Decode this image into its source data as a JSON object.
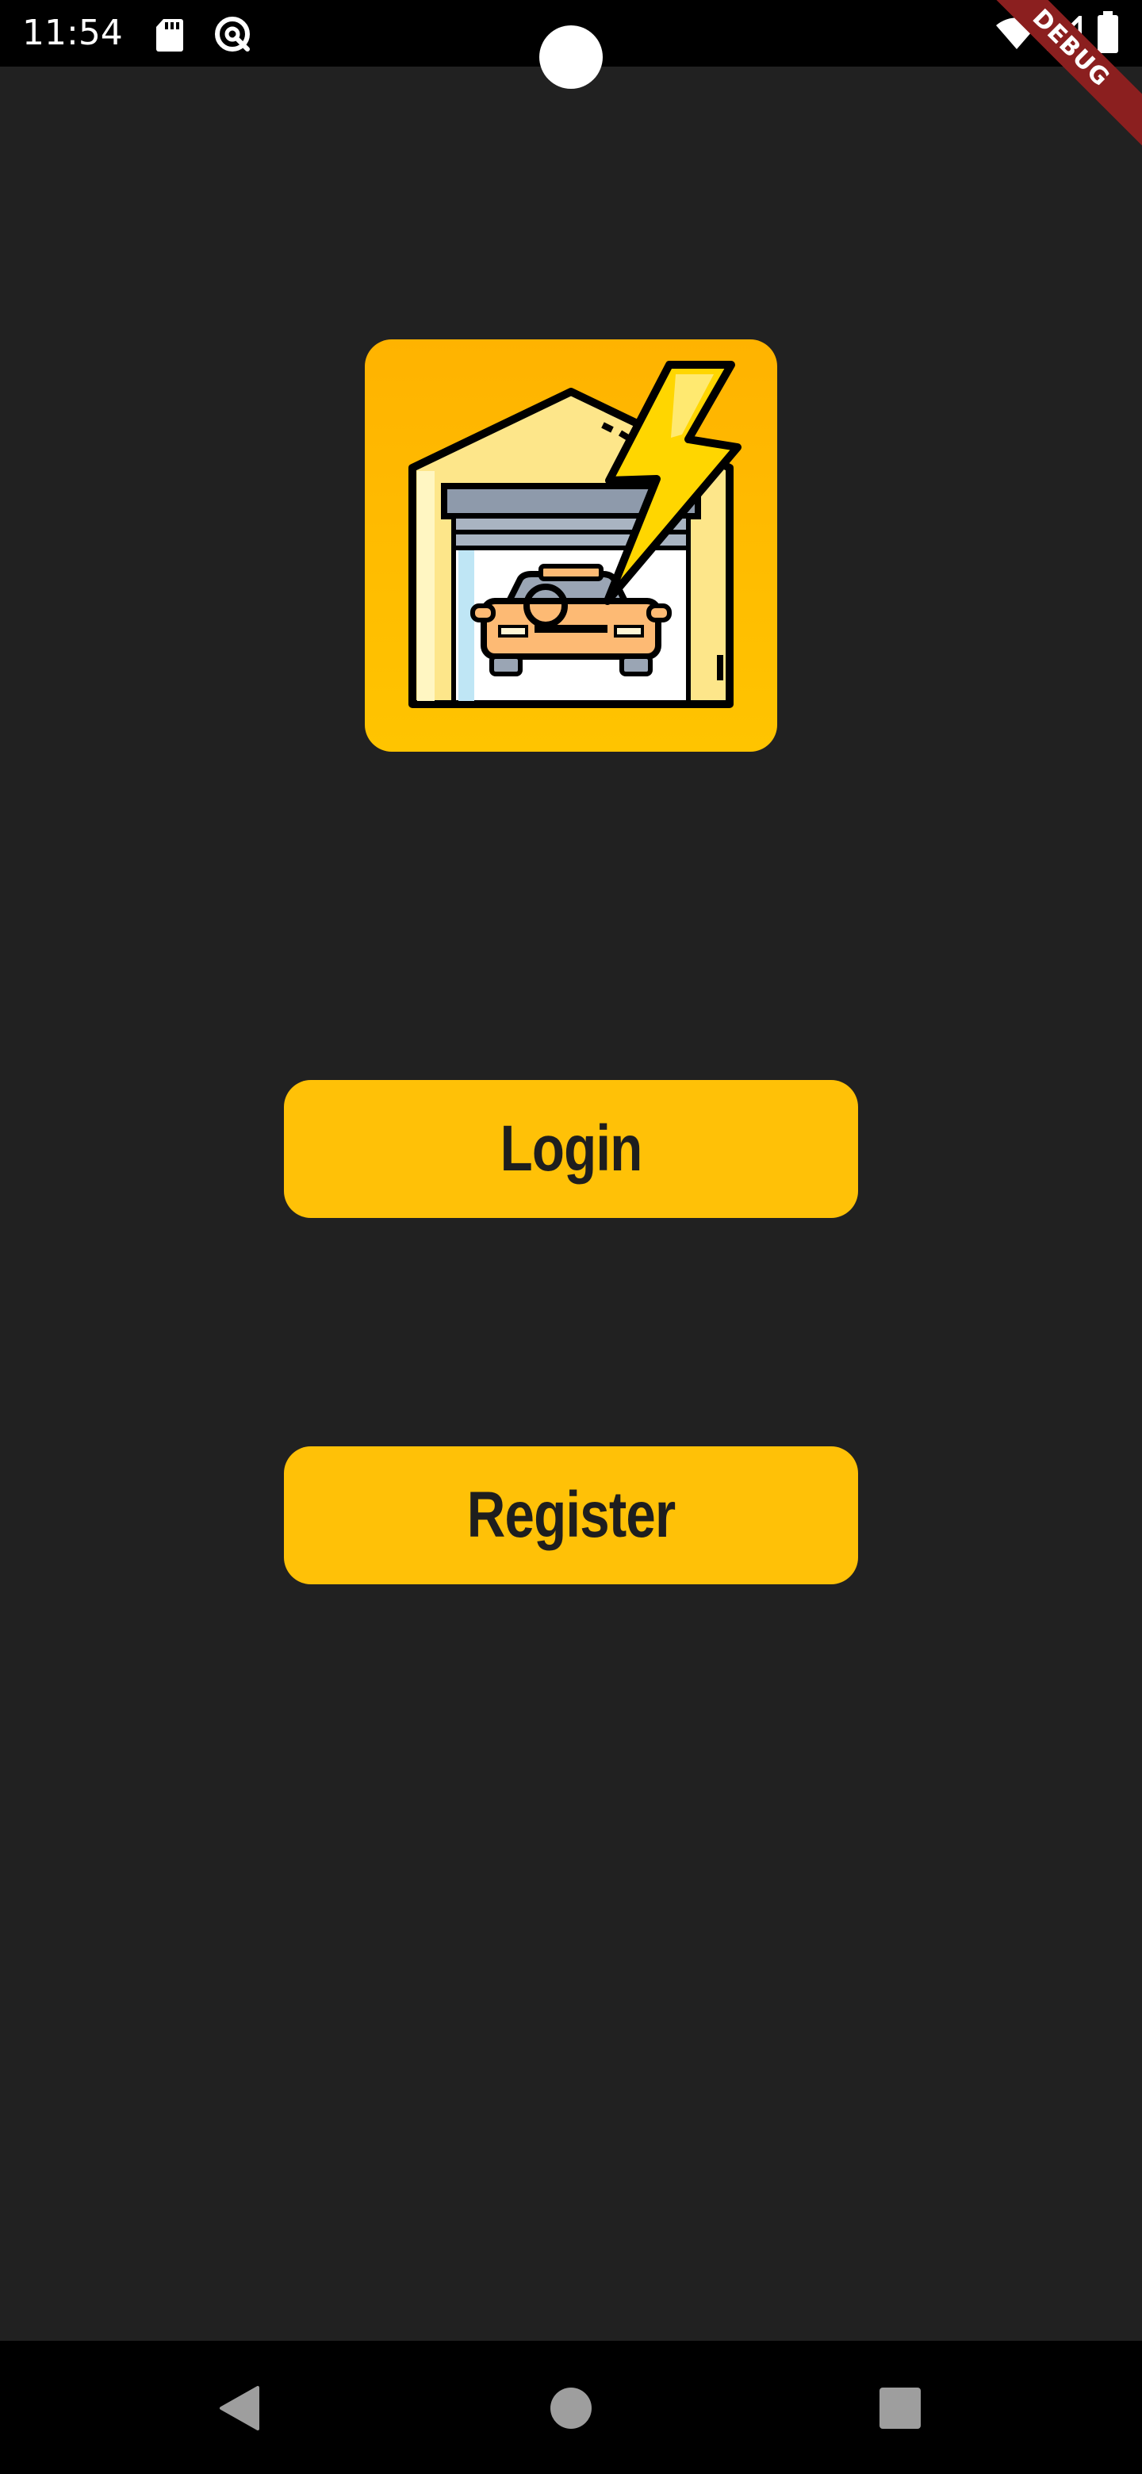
{
  "status_bar": {
    "time": "11:54",
    "icons": [
      "sd-card-icon",
      "vpn-icon",
      "wifi-icon",
      "cell-signal-icon",
      "battery-icon"
    ]
  },
  "debug_banner": {
    "label": "DEBUG",
    "color": "#8b1f1f"
  },
  "logo": {
    "icon": "garage-car-lightning-icon",
    "background_color": "#ffc107"
  },
  "actions": {
    "login_label": "Login",
    "register_label": "Register",
    "button_color": "#ffc107"
  },
  "navigation": {
    "buttons": [
      "back-icon",
      "home-icon",
      "recents-icon"
    ]
  },
  "theme": {
    "background": "#212121",
    "accent": "#ffc107"
  }
}
